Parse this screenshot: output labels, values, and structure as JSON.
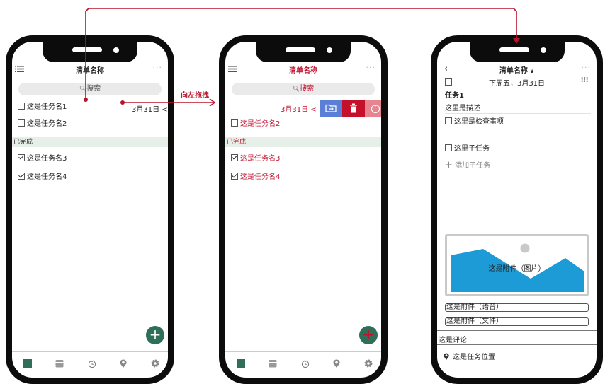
{
  "screen1": {
    "list_title": "清单名称",
    "more": "···",
    "search": "搜索",
    "tasks": [
      {
        "name": "这是任务名1",
        "date": "3月31日"
      },
      {
        "name": "这是任务名2"
      }
    ],
    "completed_header": "已完成",
    "completed": [
      {
        "name": "这是任务名3"
      },
      {
        "name": "这是任务名4"
      }
    ],
    "fab": "+"
  },
  "swipe_label": "向左拖拽",
  "screen2": {
    "list_title": "清单名称",
    "more": "···",
    "search": "搜索",
    "swiped_date": "3月31日",
    "tasks": [
      {
        "name": "这是任务名2"
      }
    ],
    "completed_header": "已完成",
    "completed": [
      {
        "name": "这是任务名3"
      },
      {
        "name": "这是任务名4"
      }
    ],
    "fab": "+",
    "actions": {
      "move_color": "#5b7fd6",
      "delete_color": "#c4102b",
      "timer_color": "#e6848f"
    }
  },
  "screen3": {
    "list_title": "清单名称",
    "more": "···",
    "date": "下周五，3月31日",
    "task_title": "任务1",
    "description": "这里是描述",
    "checklist_item": "这里是检查事项",
    "subtask": "这里子任务",
    "add_subtask": "添加子任务",
    "attachment_image": "这是附件（图片）",
    "attachment_audio": "这是附件（语音）",
    "attachment_file": "这是附件（文件）",
    "comment": "这是评论",
    "location": "这是任务位置"
  },
  "colors": {
    "accent": "#c0122f",
    "brand_green": "#2f6e58",
    "done_section": "#e7efe9",
    "image_blue": "#1d9bd7"
  }
}
